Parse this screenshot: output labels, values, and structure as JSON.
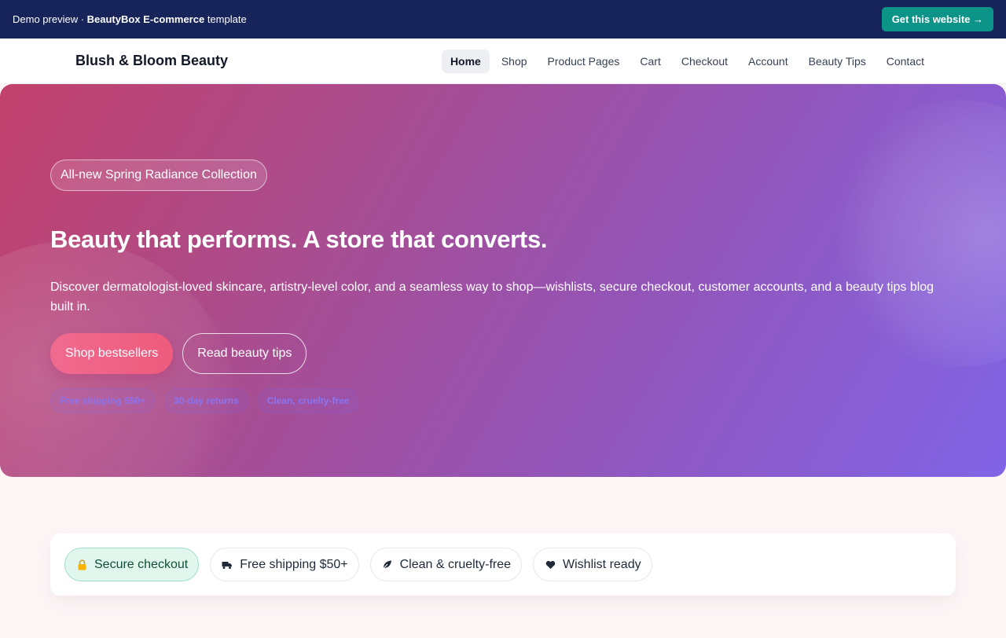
{
  "demo_bar": {
    "prefix": "Demo preview · ",
    "template_name": "BeautyBox E-commerce",
    "suffix": " template",
    "cta_label": "Get this website →"
  },
  "nav": {
    "brand": "Blush & Bloom Beauty",
    "links": [
      {
        "label": "Home",
        "active": true
      },
      {
        "label": "Shop"
      },
      {
        "label": "Product Pages"
      },
      {
        "label": "Cart"
      },
      {
        "label": "Checkout"
      },
      {
        "label": "Account"
      },
      {
        "label": "Beauty Tips"
      },
      {
        "label": "Contact"
      }
    ]
  },
  "hero": {
    "pill": "All-new Spring Radiance Collection",
    "title": "Beauty that performs. A store that converts.",
    "description": "Discover dermatologist-loved skincare, artistry-level color, and a seamless way to shop—wishlists, secure checkout, customer accounts, and a beauty tips blog built in.",
    "primary_cta": "Shop bestsellers",
    "secondary_cta": "Read beauty tips",
    "tags": [
      "Free shipping $50+",
      "30-day returns",
      "Clean, cruelty-free"
    ],
    "gradient_start": "#c2416b",
    "gradient_end": "#8064e6"
  },
  "features": [
    {
      "label": "Secure checkout",
      "icon": "lock-icon",
      "highlight": true
    },
    {
      "label": "Free shipping $50+",
      "icon": "truck-icon"
    },
    {
      "label": "Clean & cruelty-free",
      "icon": "leaf-icon"
    },
    {
      "label": "Wishlist ready",
      "icon": "heart-icon"
    }
  ],
  "colors": {
    "demo_bar_bg": "#16245a",
    "cta_teal": "#0d9488",
    "primary_pink": "#ee5b7d",
    "page_bg": "#fdf6f7"
  }
}
